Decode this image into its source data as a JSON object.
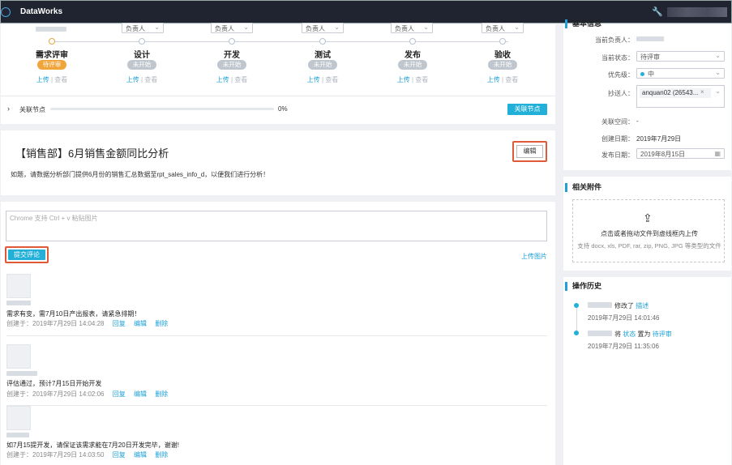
{
  "app": {
    "title": "DataWorks"
  },
  "workflow": {
    "assignee_placeholder": "负责人",
    "steps": [
      {
        "title": "需求评审",
        "status": "待评审",
        "active": true
      },
      {
        "title": "设计",
        "status": "未开始",
        "active": false
      },
      {
        "title": "开发",
        "status": "未开始",
        "active": false
      },
      {
        "title": "测试",
        "status": "未开始",
        "active": false
      },
      {
        "title": "发布",
        "status": "未开始",
        "active": false
      },
      {
        "title": "验收",
        "status": "未开始",
        "active": false
      }
    ],
    "upload_label": "上传",
    "separator": "|",
    "view_label": "查看",
    "related_nodes_label": "关联节点",
    "progress": 0,
    "progress_text": "0%",
    "related_nodes_button": "关联节点"
  },
  "requirement": {
    "title": "【销售部】6月销售金额同比分析",
    "edit_button": "编辑",
    "description": "如题，请数据分析部门提供6月份的销售汇总数据至rpt_sales_info_d，以便我们进行分析！"
  },
  "comment_box": {
    "placeholder": "Chrome 支持 Ctrl + v 粘贴图片",
    "submit_button": "提交评论",
    "upload_image": "上传图片"
  },
  "comments": [
    {
      "text": "需求有变，需7月10日产出报表，请紧急排期！",
      "created": "创建于：2019年7月29日 14:04:28",
      "reply": "回复",
      "edit": "编辑",
      "delete": "删除"
    },
    {
      "text": "评估通过，预计7月15日开始开发",
      "created": "创建于：2019年7月29日 14:02:06",
      "reply": "回复",
      "edit": "编辑",
      "delete": "删除"
    },
    {
      "text": "如7月15提开发，请保证该需求能在7月20日开发完毕，谢谢!",
      "created": "创建于：2019年7月29日 14:03:50",
      "reply": "回复",
      "edit": "编辑",
      "delete": "删除"
    }
  ],
  "sidebar": {
    "basic_info": {
      "title": "基本信息",
      "current_owner_label": "当前负责人：",
      "current_status_label": "当前状态：",
      "current_status_value": "待评审",
      "priority_label": "优先级：",
      "priority_value": "中",
      "cc_label": "抄送人：",
      "cc_value": "anquan02 (26543...",
      "related_space_label": "关联空间：",
      "related_space_value": "-",
      "created_label": "创建日期：",
      "created_value": "2019年7月29日",
      "publish_label": "发布日期：",
      "publish_value": "2019年8月15日"
    },
    "attachments": {
      "title": "相关附件",
      "upload_text": "点击或者拖动文件到虚线框内上传",
      "support_text": "支持 docx, xls, PDF, rar, zip, PNG, JPG 等类型的文件"
    },
    "history": {
      "title": "操作历史",
      "items": [
        {
          "action": "修改了",
          "target": "描述",
          "time": "2019年7月29日 14:01:46"
        },
        {
          "action": "将",
          "target": "状态",
          "mid": "置为",
          "value": "待评审",
          "time": "2019年7月29日 11:35:06"
        }
      ]
    }
  },
  "colors": {
    "accent": "#23b0d8",
    "orange": "#f0a43a",
    "highlight": "#e05a3a",
    "topbar": "#1f2430"
  }
}
